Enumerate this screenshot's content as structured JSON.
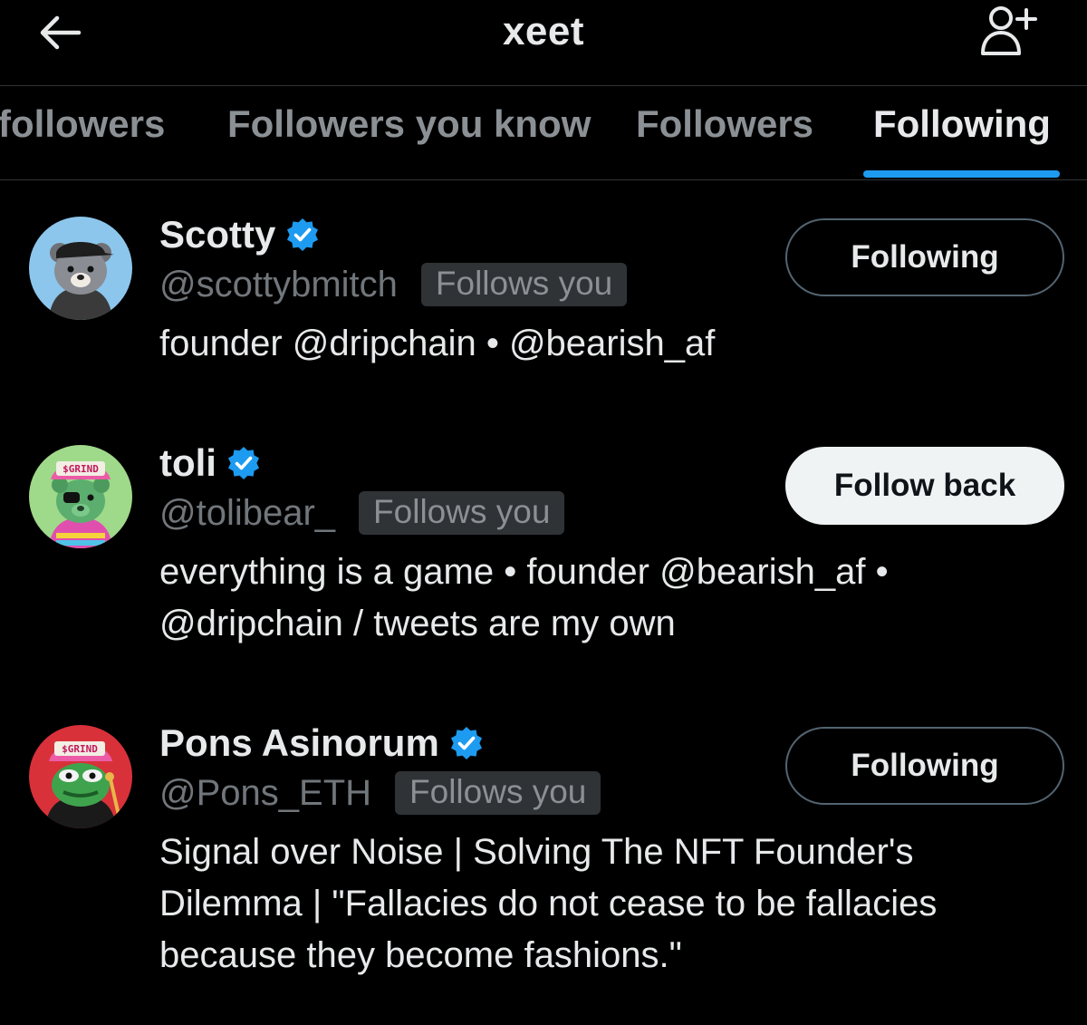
{
  "header": {
    "title": "xeet",
    "back_icon": "arrow-left-icon",
    "add_icon": "add-user-icon"
  },
  "tabs": [
    {
      "label": "followers",
      "active": false
    },
    {
      "label": "Followers you know",
      "active": false
    },
    {
      "label": "Followers",
      "active": false
    },
    {
      "label": "Following",
      "active": true
    }
  ],
  "colors": {
    "accent": "#1d9bf0",
    "background": "#000000",
    "text": "#e7e9ea",
    "muted": "#71767b"
  },
  "users": [
    {
      "name": "Scotty",
      "handle": "@scottybmitch",
      "badge": "Follows you",
      "verified": true,
      "bio": "founder @dripchain • @bearish_af",
      "button": "Following",
      "button_style": "outline"
    },
    {
      "name": "toli",
      "handle": "@tolibear_",
      "badge": "Follows you",
      "verified": true,
      "bio": "everything is a game • founder @bearish_af • @dripchain / tweets are my own",
      "button": "Follow back",
      "button_style": "solid",
      "avatar_text": "$GRIND"
    },
    {
      "name": "Pons Asinorum",
      "handle": "@Pons_ETH",
      "badge": "Follows you",
      "verified": true,
      "bio": "Signal over Noise | Solving The NFT Founder's Dilemma | \"Fallacies do not cease to be fallacies because they become fashions.\"",
      "button": "Following",
      "button_style": "outline",
      "avatar_text": "$GRIND"
    }
  ]
}
